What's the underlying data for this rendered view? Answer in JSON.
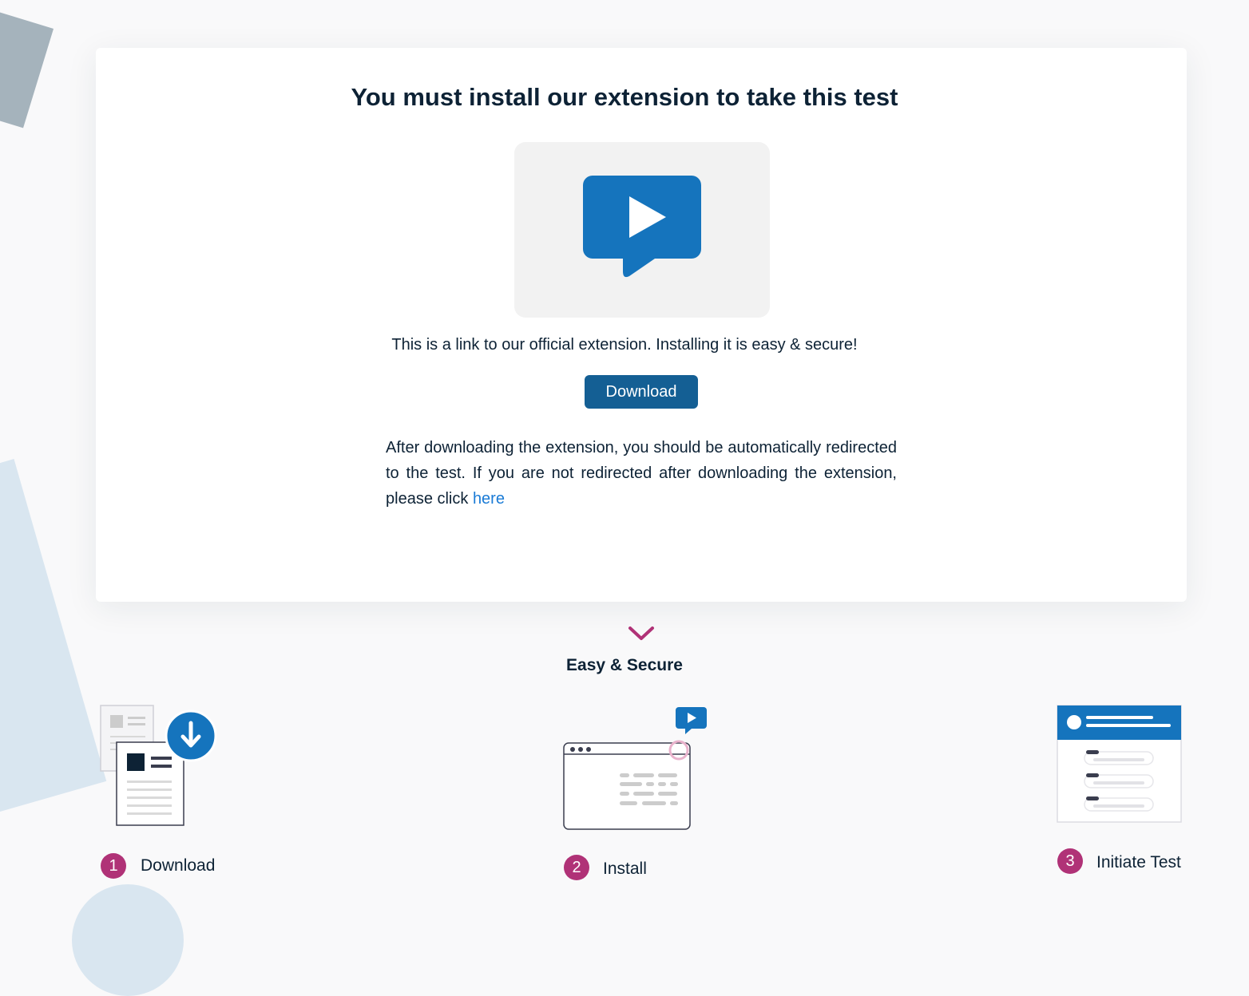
{
  "card": {
    "title": "You must install our extension to take this test",
    "intro": "This is a link to our official extension. Installing it is easy & secure!",
    "download_label": "Download",
    "after_text": "After downloading the extension, you should be automatically redirected to the test. If you are not redirected after downloading the extension, please click ",
    "here_link": "here"
  },
  "section": {
    "title": "Easy & Secure"
  },
  "steps": [
    {
      "number": "1",
      "label": "Download",
      "icon": "download-document-illustration"
    },
    {
      "number": "2",
      "label": "Install",
      "icon": "browser-window-illustration"
    },
    {
      "number": "3",
      "label": "Initiate Test",
      "icon": "test-form-illustration"
    }
  ],
  "colors": {
    "primary_blue": "#1574bd",
    "button_blue": "#145f94",
    "accent_magenta": "#b03277",
    "text_dark": "#0d2235",
    "link_blue": "#1a7bd6"
  }
}
